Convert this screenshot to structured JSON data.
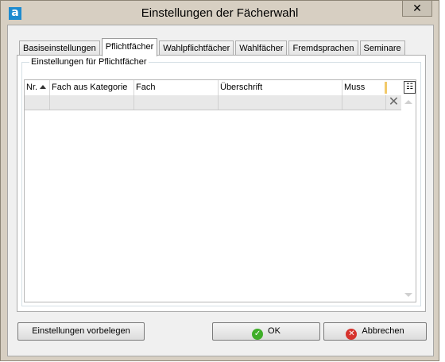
{
  "window": {
    "title": "Einstellungen der Fächerwahl",
    "app_icon_letter": "a",
    "close_glyph": "✕"
  },
  "tabs": [
    {
      "label": "Basiseinstellungen",
      "active": false
    },
    {
      "label": "Pflichtfächer",
      "active": true
    },
    {
      "label": "Wahlpflichtfächer",
      "active": false
    },
    {
      "label": "Wahlfächer",
      "active": false
    },
    {
      "label": "Fremdsprachen",
      "active": false
    },
    {
      "label": "Seminare",
      "active": false
    }
  ],
  "group": {
    "legend": "Einstellungen für Pflichtfächer"
  },
  "grid": {
    "columns": [
      "Nr.",
      "Fach aus Kategorie",
      "Fach",
      "Überschrift",
      "Muss"
    ],
    "sort_column": "Nr.",
    "sort_direction": "ascending",
    "column_chooser_icon": "column-chooser-icon",
    "rows": [
      {
        "nr": "",
        "fach_aus_kategorie": "",
        "fach": "",
        "ueberschrift": "",
        "muss": ""
      }
    ],
    "delete_glyph": "✕"
  },
  "buttons": {
    "preset": "Einstellungen vorbelegen",
    "ok": "OK",
    "cancel": "Abbrechen"
  },
  "icons": {
    "ok": "check-circle-icon",
    "cancel": "x-circle-icon"
  },
  "colors": {
    "ok_icon": "#3fae29",
    "cancel_icon": "#d6332d",
    "app_icon": "#1e8bcf"
  }
}
